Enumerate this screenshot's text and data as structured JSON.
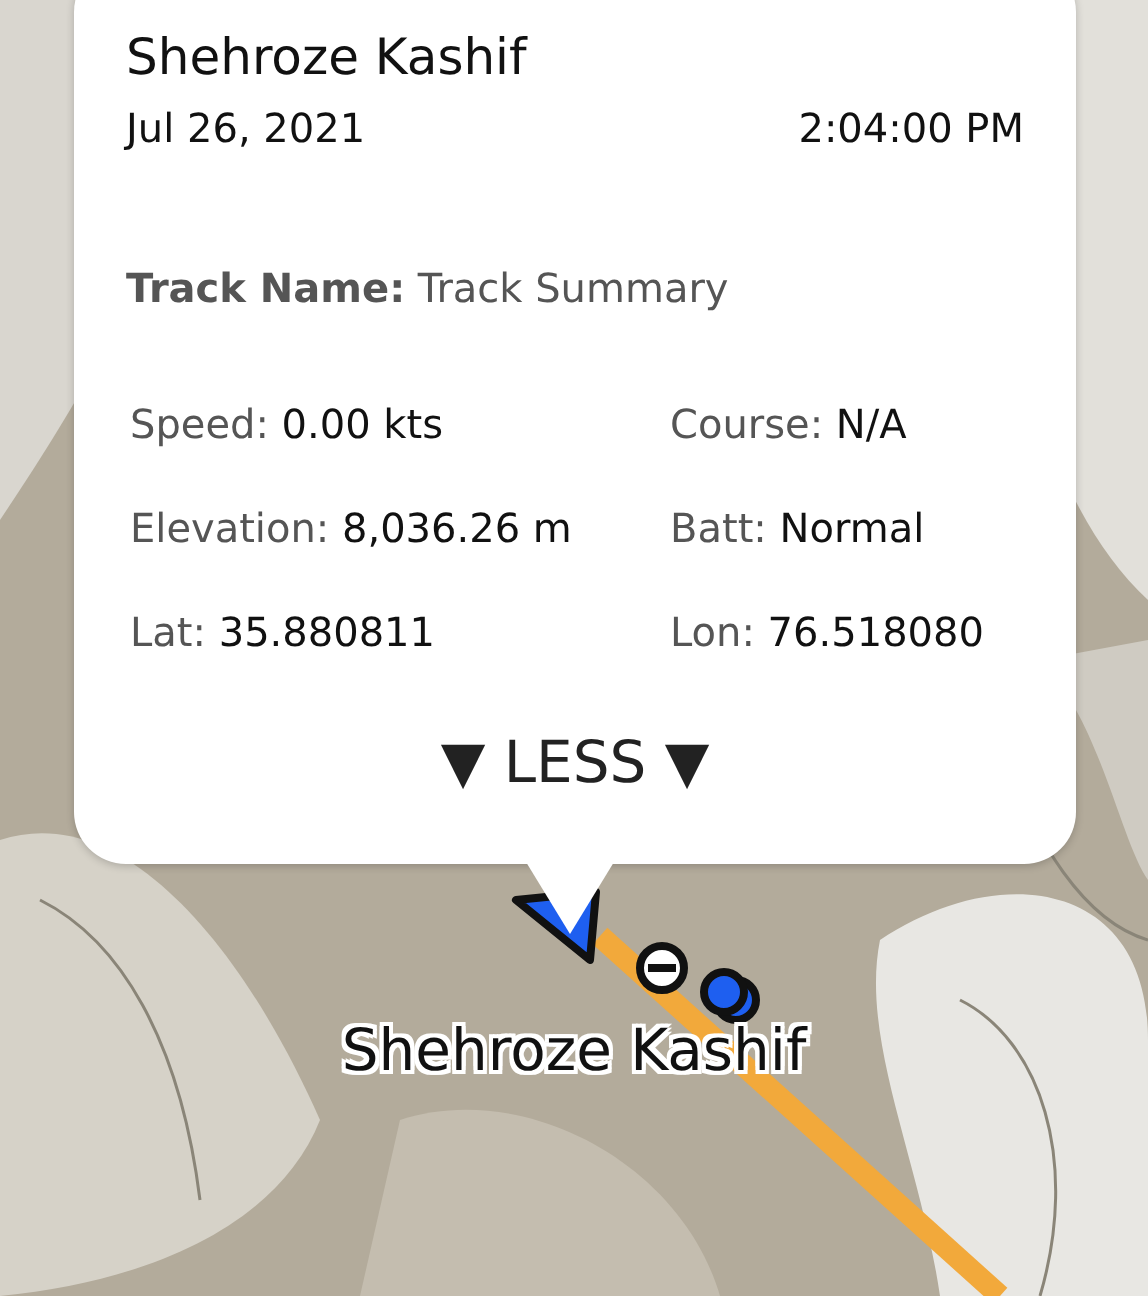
{
  "popup": {
    "name": "Shehroze Kashif",
    "date": "Jul 26, 2021",
    "time": "2:04:00 PM",
    "track": {
      "label": "Track Name:",
      "value": "Track Summary"
    },
    "fields": [
      {
        "label": "Speed:",
        "value": "0.00 kts"
      },
      {
        "label": "Course:",
        "value": "N/A"
      },
      {
        "label": "Elevation:",
        "value": "8,036.26 m"
      },
      {
        "label": "Batt:",
        "value": "Normal"
      },
      {
        "label": "Lat:",
        "value": "35.880811"
      },
      {
        "label": "Lon:",
        "value": "76.518080"
      }
    ],
    "toggle": "▼ LESS ▼"
  },
  "map": {
    "kind": "picture",
    "marker_label": "Shehroze Kashif"
  }
}
